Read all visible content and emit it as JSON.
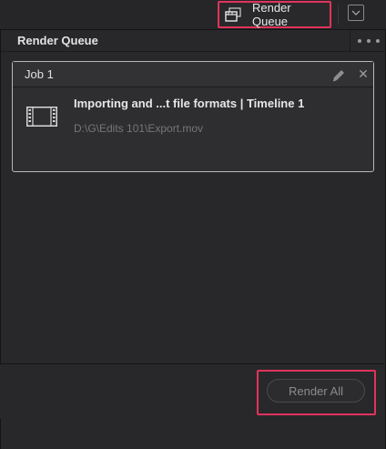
{
  "topbar": {
    "render_queue_label": "Render Queue"
  },
  "panel": {
    "title": "Render Queue"
  },
  "jobs": [
    {
      "title": "Job 1",
      "name": "Importing and ...t file formats | Timeline 1",
      "path": "D:\\G\\Edits 101\\Export.mov"
    }
  ],
  "footer": {
    "render_all_label": "Render All"
  },
  "colors": {
    "highlight": "#e0345c",
    "panel_bg": "#28282a"
  },
  "icons": {
    "render_queue": "render-queue-icon",
    "dropdown": "chevron-down-icon",
    "more": "more-options-icon",
    "edit": "pencil-icon",
    "close": "close-icon",
    "clip": "film-strip-icon"
  }
}
